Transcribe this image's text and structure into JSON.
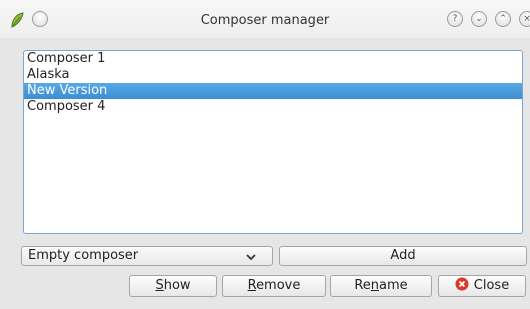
{
  "window": {
    "title": "Composer manager",
    "controls": {
      "help": "?",
      "minimize": "⌄",
      "maximize": "⌃",
      "close": "×"
    }
  },
  "composers": [
    {
      "label": "Composer 1",
      "selected": false
    },
    {
      "label": "Alaska",
      "selected": false
    },
    {
      "label": "New Version",
      "selected": true
    },
    {
      "label": "Composer 4",
      "selected": false
    }
  ],
  "template_combo": {
    "value": "Empty composer"
  },
  "buttons": {
    "add": "Add",
    "show_mnemonic": "S",
    "show_rest": "how",
    "remove_mnemonic": "R",
    "remove_rest": "emove",
    "rename_pre": "Re",
    "rename_mnemonic": "n",
    "rename_post": "ame",
    "close": "Close"
  },
  "colors": {
    "selection": "#3c8ed2",
    "close_icon": "#d73a2a"
  }
}
